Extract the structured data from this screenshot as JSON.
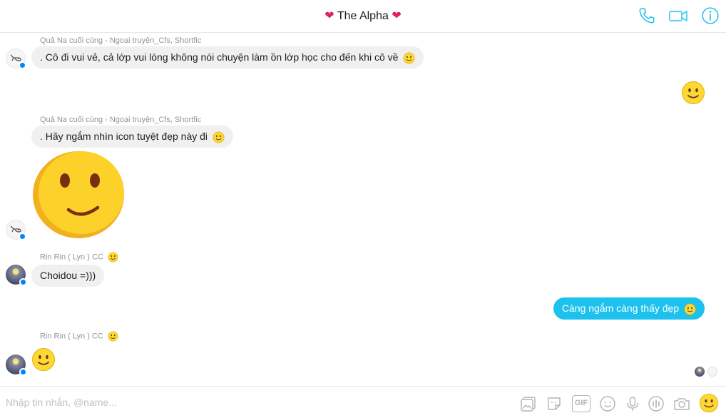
{
  "header": {
    "title": "The Alpha",
    "heart_left": "❤",
    "heart_right": "❤",
    "icons": [
      "phone-icon",
      "video-icon",
      "info-icon"
    ],
    "accent": "#1dc1ee"
  },
  "messages": [
    {
      "sender": "Quả Na cuối cùng - Ngoại truyện_Cfs, Shortfic",
      "text": ". Cô đi vui vẻ, cả lớp vui lòng không nói chuyện làm ồn lớp học cho đến khi cô về"
    },
    {
      "sender": "Quả Na cuối cùng - Ngoại truyện_Cfs, Shortfic",
      "text": ". Hãy ngắm nhìn icon tuyệt đẹp này đi"
    },
    {
      "sender": "Rin Rin ( Lyn ) CC",
      "text": "Choidou =)))"
    },
    {
      "outgoing_text": "Càng ngắm càng thấy đẹp"
    },
    {
      "sender": "Rin Rin ( Lyn ) CC"
    }
  ],
  "composer": {
    "placeholder": "Nhập tin nhắn, @name...",
    "tools": [
      "image-icon",
      "sticker-icon",
      "gif-icon",
      "emoji-icon",
      "microphone-icon",
      "audio-wave-icon",
      "camera-icon",
      "like-emoji-icon"
    ],
    "gif_label": "GIF"
  },
  "colors": {
    "incoming_bubble": "#f1f0f0",
    "outgoing_bubble": "#1dc1ee",
    "messenger_badge": "#0084ff",
    "emoji_yellow": "#fdd835"
  }
}
